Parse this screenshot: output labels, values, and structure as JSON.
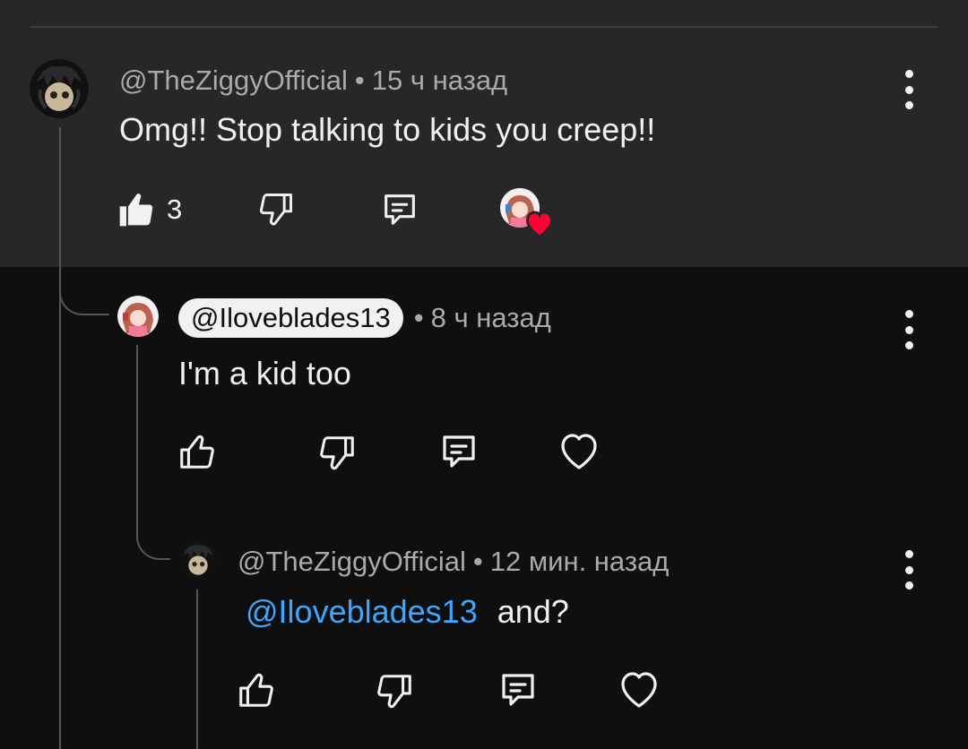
{
  "comments": [
    {
      "author": "@TheZiggyOfficial",
      "separator": "•",
      "time": "15 ч назад",
      "text": "Omg!! Stop talking to kids you creep!!",
      "likes": "3",
      "liked": true,
      "creator_heart": true
    },
    {
      "author": "@Iloveblades13",
      "separator": "•",
      "time": "8 ч назад",
      "text": "I'm a kid too",
      "author_highlighted": true
    },
    {
      "author": "@TheZiggyOfficial",
      "separator": "•",
      "time": "12 мин. назад",
      "mention": "@Iloveblades13",
      "text": "and?"
    }
  ],
  "icons": {
    "like": "thumbs-up-icon",
    "dislike": "thumbs-down-icon",
    "reply": "reply-icon",
    "heart": "heart-icon",
    "more": "more-vertical-icon"
  },
  "colors": {
    "background": "#0f0f0f",
    "highlight_band": "#272727",
    "mention": "#3ea6ff",
    "heart": "#ff0033",
    "meta_text": "#aaaaaa"
  }
}
